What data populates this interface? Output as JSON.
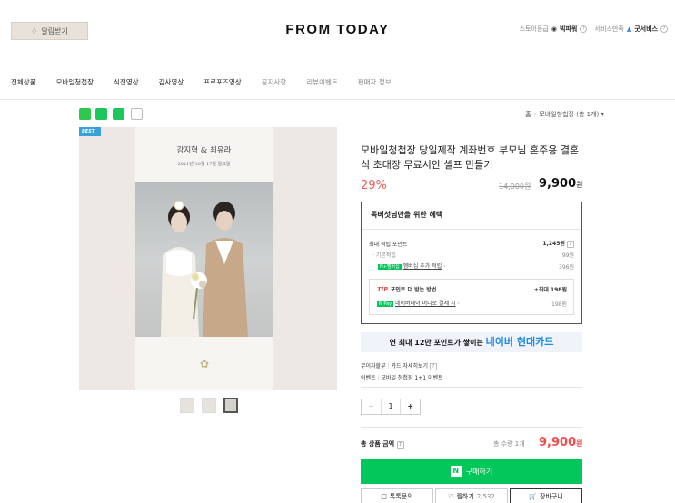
{
  "header": {
    "alarm_label": "알림받기",
    "logo": "FROM TODAY",
    "store_grade_label": "스토어등급",
    "store_grade_value": "빅파워",
    "service_label": "서비스만족",
    "service_value": "굿서비스"
  },
  "nav": {
    "items": [
      "전체상품",
      "모바일청첩장",
      "식전영상",
      "감사영상",
      "프로포즈영상",
      "공지사항",
      "리뷰이벤트",
      "판매자 정보"
    ]
  },
  "breadcrumb": {
    "home": "홈",
    "category": "모바일청첩장",
    "count": "(총 1개)"
  },
  "product_image": {
    "badge": "BEST",
    "names": "강지혁 & 최유라",
    "date": "2021년 10월 17일 일요일"
  },
  "product": {
    "title": "모바일청첩장 당일제작 계좌번호 부모님 혼주용 결혼식 초대장 무료시안 셀프 만들기",
    "discount": "29%",
    "original_price": "14,000원",
    "final_price": "9,900",
    "currency": "원"
  },
  "benefit": {
    "title": "독버섯님만을 위한 혜택",
    "max_points_label": "최대 적립 포인트",
    "max_points_value": "1,245원",
    "basic_label": "기본적립",
    "basic_value": "99원",
    "membership_badge": "N+멤버십",
    "membership_label": "멤버십 추가 적립",
    "membership_value": "396원",
    "tip_prefix": "TIP.",
    "tip_label": "포인트 더 받는 방법",
    "tip_value": "+최대 198원",
    "npay_badge": "N Pay",
    "npay_label": "네이버페이 머니로 결제 시",
    "npay_value": "198원"
  },
  "card_banner": {
    "prefix": "연 최대 12만 포인트가 쌓이는",
    "highlight": "네이버 현대카드"
  },
  "info": {
    "interest_free_label": "무이자할부",
    "interest_free_link": "카드 자세히보기",
    "event_label": "이벤트",
    "event_value": "모바일 청첩장 1+1 이벤트"
  },
  "quantity": {
    "minus": "−",
    "value": "1",
    "plus": "+"
  },
  "total": {
    "label": "총 상품 금액",
    "count": "총 수량 1개",
    "price": "9,900",
    "currency": "원"
  },
  "actions": {
    "buy": "구매하기",
    "talk": "톡톡문의",
    "wish": "찜하기",
    "wish_count": "2,532",
    "cart": "장바구니"
  },
  "colors": {
    "accent_green": "#03c75a",
    "price_red": "#f04c4c",
    "discount_red": "#f05c5c",
    "naver_card_blue": "#1a8ae6"
  }
}
